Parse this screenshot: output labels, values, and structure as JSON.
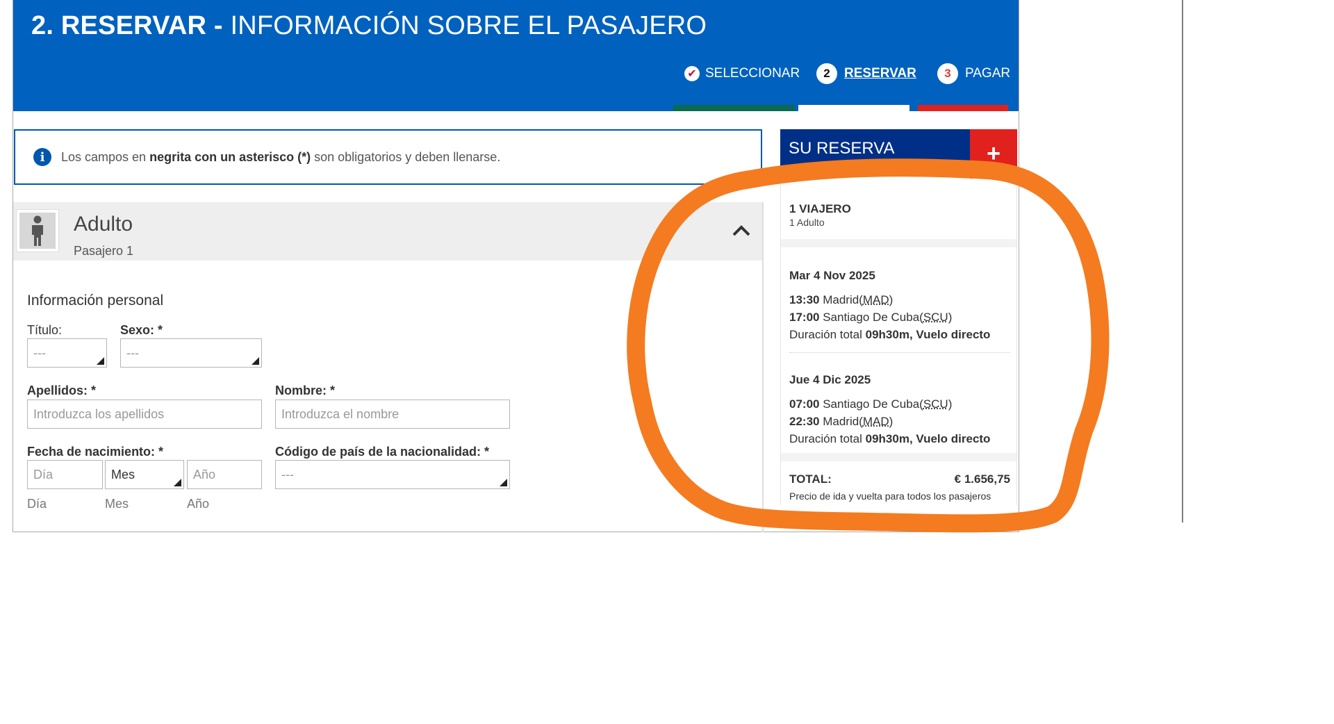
{
  "header": {
    "step_number": "2.",
    "title_bold": "RESERVAR -",
    "title_rest": "INFORMACIÓN SOBRE EL PASAJERO",
    "steps": [
      {
        "label": "SELECCIONAR",
        "state": "done"
      },
      {
        "number": "2",
        "label": "RESERVAR",
        "state": "active"
      },
      {
        "number": "3",
        "label": "PAGAR",
        "state": "future"
      }
    ],
    "colors": {
      "brand_blue": "#0061bf",
      "done_bar": "#0b6b52",
      "active_bar": "#ffffff",
      "future_bar": "#e1211d"
    }
  },
  "notice": {
    "icon": "info-icon",
    "text_before": "Los campos en ",
    "text_bold": "negrita con un asterisco (*)",
    "text_after": " son obligatorios y deben llenarse."
  },
  "passenger": {
    "type": "Adulto",
    "subtitle": "Pasajero 1",
    "section_title": "Información personal",
    "fields": {
      "title_label": "Título:",
      "title_value": "---",
      "sex_label": "Sexo: *",
      "sex_value": "---",
      "surname_label": "Apellidos: *",
      "surname_placeholder": "Introduzca los apellidos",
      "name_label": "Nombre: *",
      "name_placeholder": "Introduzca el nombre",
      "dob_label": "Fecha de nacimiento: *",
      "day_placeholder": "Día",
      "month_value": "Mes",
      "year_placeholder": "Año",
      "day_hint": "Día",
      "month_hint": "Mes",
      "year_hint": "Año",
      "country_label": "Código de país de la nacionalidad: *",
      "country_value": "---"
    }
  },
  "summary": {
    "title": "SU RESERVA",
    "plus": "+",
    "travelers_title": "1 VIAJERO",
    "travelers_sub": "1 Adulto",
    "outbound": {
      "date": "Mar 4 Nov 2025",
      "dep_time": "13:30",
      "dep_city": "Madrid(",
      "dep_code": "MAD",
      "arr_time": "17:00",
      "arr_city": "Santiago De Cuba(",
      "arr_code": "SCU",
      "duration_label": "Duración total ",
      "duration_value": "09h30m, Vuelo directo"
    },
    "inbound": {
      "date": "Jue 4 Dic 2025",
      "dep_time": "07:00",
      "dep_city": "Santiago De Cuba(",
      "dep_code": "SCU",
      "arr_time": "22:30",
      "arr_city": "Madrid(",
      "arr_code": "MAD",
      "duration_label": "Duración total ",
      "duration_value": "09h30m, Vuelo directo"
    },
    "total_label": "TOTAL:",
    "total_value": "€ 1.656,75",
    "total_note": "Precio de ida y vuelta para todos los pasajeros",
    "annotation_color": "#f47b20"
  }
}
